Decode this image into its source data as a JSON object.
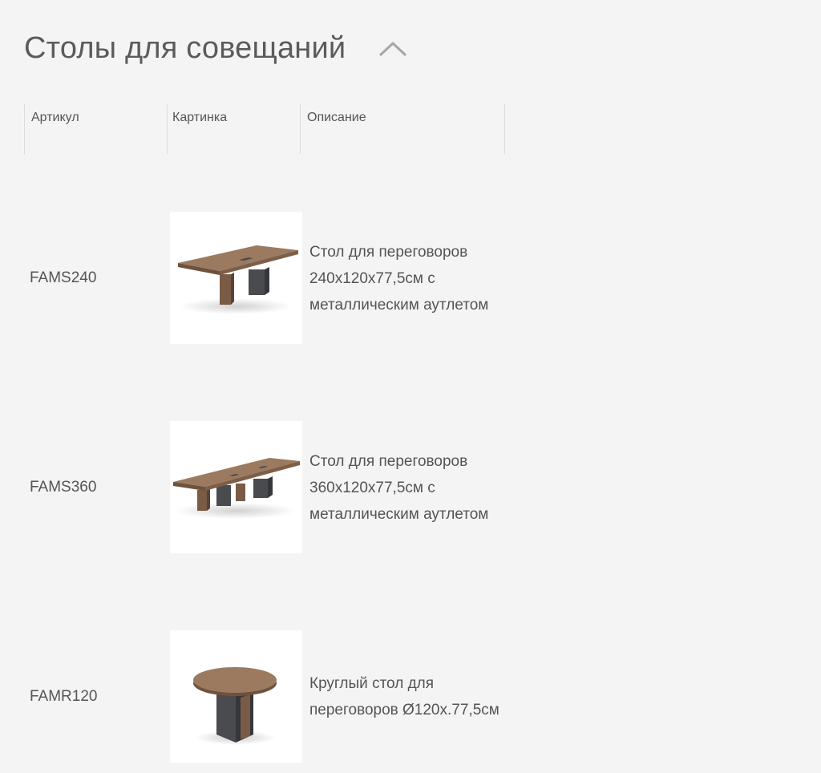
{
  "section": {
    "title": "Столы для совещаний"
  },
  "table": {
    "headers": {
      "article": "Артикул",
      "picture": "Картинка",
      "description": "Описание"
    },
    "rows": [
      {
        "article": "FAMS240",
        "description": "Стол для переговоров 240x120x77,5см с металлическим аутлетом",
        "image": "rectangular-conference-table-icon"
      },
      {
        "article": "FAMS360",
        "description": "Стол для переговоров 360x120x77,5см с металлическим аутлетом",
        "image": "long-conference-table-icon"
      },
      {
        "article": "FAMR120",
        "description": "Круглый стол для переговоров Ø120x.77,5см",
        "image": "round-table-icon"
      }
    ]
  },
  "colors": {
    "background": "#f4f4f4",
    "text": "#555555",
    "wood": "#8a6a52",
    "base": "#4a4b4e"
  }
}
